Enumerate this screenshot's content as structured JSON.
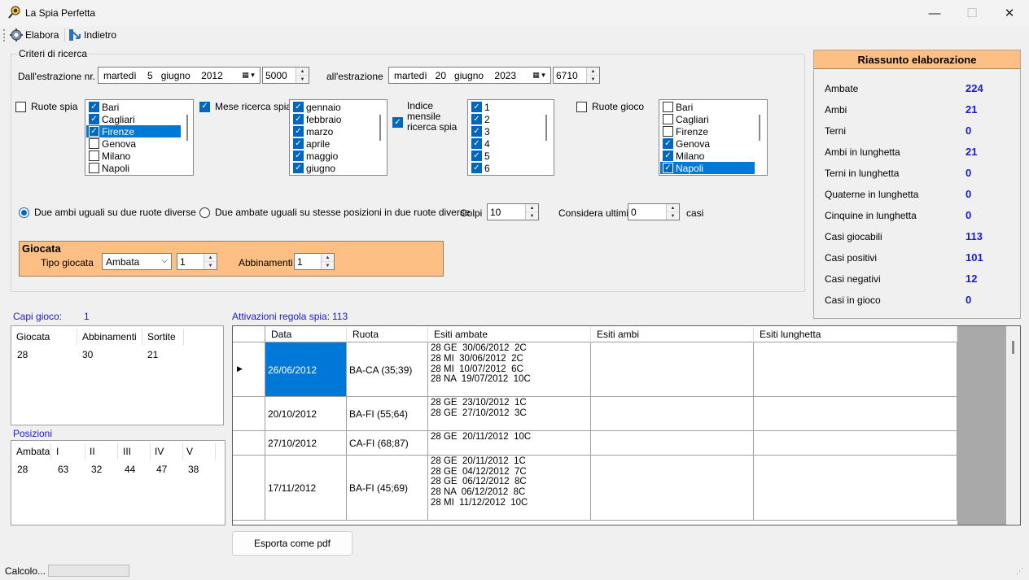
{
  "window": {
    "title": "La Spia Perfetta",
    "minimize": "—",
    "maximize": "☐",
    "close": "✕"
  },
  "toolbar": {
    "elabora": "Elabora",
    "indietro": "Indietro"
  },
  "criteri": {
    "group_label": "Criteri di ricerca",
    "dall_label": "Dall'estrazione nr.",
    "date_from": "martedì    5   giugno    2012",
    "nr_from": "5000",
    "all_label": "all'estrazione",
    "date_to": "martedì   20   giugno    2023",
    "nr_to": "6710"
  },
  "ruote_spia": {
    "label": "Ruote spia",
    "checked": false,
    "items": [
      {
        "label": "Bari",
        "checked": true,
        "selected": false
      },
      {
        "label": "Cagliari",
        "checked": true,
        "selected": false
      },
      {
        "label": "Firenze",
        "checked": true,
        "selected": true
      },
      {
        "label": "Genova",
        "checked": false,
        "selected": false
      },
      {
        "label": "Milano",
        "checked": false,
        "selected": false
      },
      {
        "label": "Napoli",
        "checked": false,
        "selected": false
      }
    ]
  },
  "mese": {
    "label": "Mese ricerca spia",
    "checked": true,
    "items": [
      {
        "label": "gennaio",
        "checked": true
      },
      {
        "label": "febbraio",
        "checked": true
      },
      {
        "label": "marzo",
        "checked": true
      },
      {
        "label": "aprile",
        "checked": true
      },
      {
        "label": "maggio",
        "checked": true
      },
      {
        "label": "giugno",
        "checked": true
      }
    ]
  },
  "indice": {
    "label_1": "Indice",
    "label_2": "mensile",
    "label_3": "ricerca spia",
    "checked": true,
    "items": [
      {
        "label": "1",
        "checked": true
      },
      {
        "label": "2",
        "checked": true
      },
      {
        "label": "3",
        "checked": true
      },
      {
        "label": "4",
        "checked": true
      },
      {
        "label": "5",
        "checked": true
      },
      {
        "label": "6",
        "checked": true
      }
    ]
  },
  "ruote_gioco": {
    "label": "Ruote gioco",
    "checked": false,
    "items": [
      {
        "label": "Bari",
        "checked": false,
        "selected": false
      },
      {
        "label": "Cagliari",
        "checked": false,
        "selected": false
      },
      {
        "label": "Firenze",
        "checked": false,
        "selected": false
      },
      {
        "label": "Genova",
        "checked": true,
        "selected": false
      },
      {
        "label": "Milano",
        "checked": true,
        "selected": false
      },
      {
        "label": "Napoli",
        "checked": true,
        "selected": true
      }
    ]
  },
  "options": {
    "radio1": "Due ambi uguali su due ruote diverse",
    "radio2": "Due ambate uguali su stesse posizioni in due ruote diverse",
    "colpi_label": "Colpi",
    "colpi": "10",
    "considera_label": "Considera ultimi",
    "considera": "0",
    "casi_label": "casi"
  },
  "giocata": {
    "title": "Giocata",
    "tipo_label": "Tipo giocata",
    "tipo": "Ambata",
    "tipo_num": "1",
    "abbinamenti_label": "Abbinamenti",
    "abbinamenti": "1"
  },
  "summary": {
    "title": "Riassunto elaborazione",
    "rows": [
      {
        "label": "Ambate",
        "value": "224"
      },
      {
        "label": "Ambi",
        "value": "21"
      },
      {
        "label": "Terni",
        "value": "0"
      },
      {
        "label": "Ambi in lunghetta",
        "value": "21"
      },
      {
        "label": "Terni in lunghetta",
        "value": "0"
      },
      {
        "label": "Quaterne in lunghetta",
        "value": "0"
      },
      {
        "label": "Cinquine in lunghetta",
        "value": "0"
      },
      {
        "label": "Casi giocabili",
        "value": "113"
      },
      {
        "label": "Casi positivi",
        "value": "101"
      },
      {
        "label": "Casi negativi",
        "value": "12"
      },
      {
        "label": "Casi in gioco",
        "value": "0"
      }
    ]
  },
  "capi": {
    "label": "Capi gioco:",
    "count": "1",
    "headers": [
      "Giocata",
      "Abbinamenti",
      "Sortite"
    ],
    "values": [
      "28",
      "30",
      "21"
    ]
  },
  "posizioni": {
    "label": "Posizioni",
    "headers": [
      "Ambata",
      "I",
      "II",
      "III",
      "IV",
      "V"
    ],
    "values": [
      "28",
      "63",
      "32",
      "44",
      "47",
      "38"
    ]
  },
  "attivazioni": {
    "label": "Attivazioni regola spia:",
    "count": "113",
    "headers": [
      "Data",
      "Ruota",
      "Esiti ambate",
      "Esiti ambi",
      "Esiti lunghetta"
    ],
    "rows": [
      {
        "data": "26/06/2012",
        "ruota": "BA-CA (35;39)",
        "ambate": "28 GE  30/06/2012  2C\n28 MI  30/06/2012  2C\n28 MI  10/07/2012  6C\n28 NA  19/07/2012  10C",
        "selected": true
      },
      {
        "data": "20/10/2012",
        "ruota": "BA-FI (55;64)",
        "ambate": "28 GE  23/10/2012  1C\n28 GE  27/10/2012  3C",
        "selected": false
      },
      {
        "data": "27/10/2012",
        "ruota": "CA-FI (68;87)",
        "ambate": "28 GE  20/11/2012  10C",
        "selected": false
      },
      {
        "data": "17/11/2012",
        "ruota": "BA-FI (45;69)",
        "ambate": "28 GE  20/11/2012  1C\n28 GE  04/12/2012  7C\n28 GE  06/12/2012  8C\n28 NA  06/12/2012  8C\n28 MI  11/12/2012  10C",
        "selected": false
      }
    ]
  },
  "export_button": "Esporta come pdf",
  "status": "Calcolo..."
}
